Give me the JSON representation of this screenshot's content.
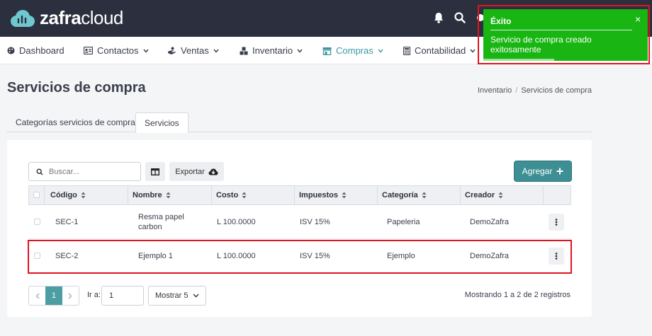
{
  "app": {
    "logo_bold": "zafra",
    "logo_light": "cloud"
  },
  "nav": {
    "items": [
      {
        "label": "Dashboard",
        "icon": "palette-icon"
      },
      {
        "label": "Contactos",
        "icon": "contact-card-icon"
      },
      {
        "label": "Ventas",
        "icon": "sales-hand-icon"
      },
      {
        "label": "Inventario",
        "icon": "boxes-icon"
      },
      {
        "label": "Compras",
        "icon": "store-icon",
        "active": true
      },
      {
        "label": "Contabilidad",
        "icon": "calculator-icon"
      }
    ]
  },
  "page": {
    "title": "Servicios de compra",
    "breadcrumb": [
      "Inventario",
      "Servicios de compra"
    ]
  },
  "tabs": [
    {
      "label": "Categorías servicios de compra"
    },
    {
      "label": "Servicios",
      "active": true
    }
  ],
  "toolbar": {
    "search_placeholder": "Buscar...",
    "export_label": "Exportar",
    "add_label": "Agregar"
  },
  "table": {
    "columns": [
      "Código",
      "Nombre",
      "Costo",
      "Impuestos",
      "Categoría",
      "Creador"
    ],
    "rows": [
      {
        "codigo": "SEC-1",
        "nombre_line1": "Resma papel",
        "nombre_line2": "carbon",
        "costo": "L 100.0000",
        "impuestos": "ISV 15%",
        "categoria": "Papeleria",
        "creador": "DemoZafra"
      },
      {
        "codigo": "SEC-2",
        "nombre_line1": "Ejemplo 1",
        "nombre_line2": "",
        "costo": "L 100.0000",
        "impuestos": "ISV 15%",
        "categoria": "Ejemplo",
        "creador": "DemoZafra"
      }
    ]
  },
  "pagination": {
    "current_page": "1",
    "goto_label": "Ir a:",
    "goto_value": "1",
    "page_size_label": "Mostrar 5",
    "summary": "Mostrando 1 a 2 de 2 registros"
  },
  "toast": {
    "title": "Éxito",
    "message": "Servicio de compra creado exitosamente",
    "close": "×",
    "color": "#19b513"
  },
  "colors": {
    "topbar": "#2b2f3e",
    "accent": "#3e8f93",
    "highlight": "#e0141f"
  }
}
